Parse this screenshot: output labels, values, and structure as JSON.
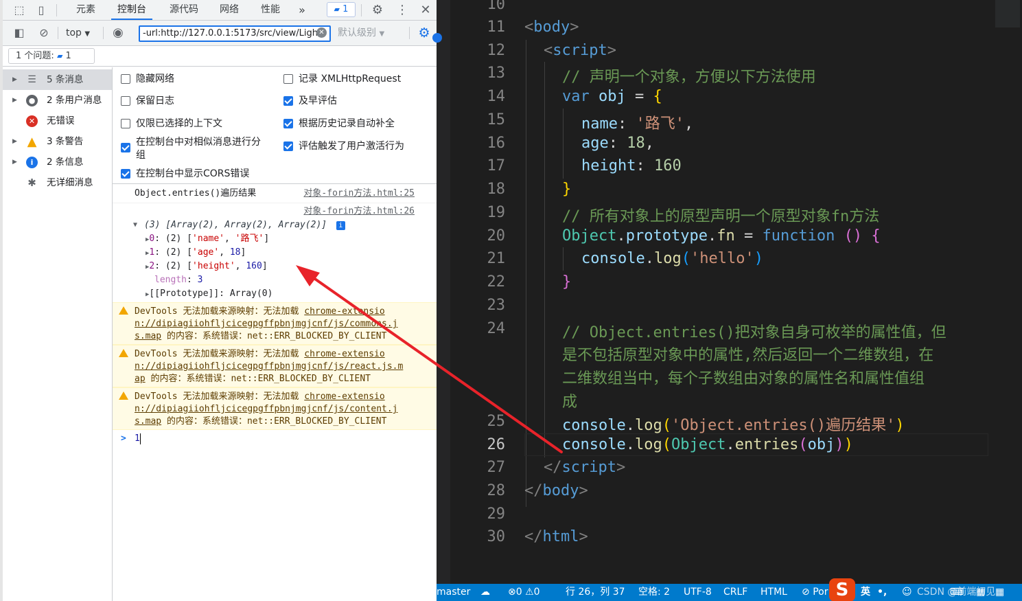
{
  "devtools": {
    "tabs": [
      {
        "label": "元素"
      },
      {
        "label": "控制台"
      },
      {
        "label": "源代码"
      },
      {
        "label": "网络"
      },
      {
        "label": "性能"
      }
    ],
    "more_tabs": "»",
    "message_badge": "1",
    "context_select": "top",
    "filter_value": "-url:http://127.0.0.1:5173/src/view/Ligh",
    "level_select": "默认级别",
    "issues_label": "1 个问题:",
    "issues_count": "1",
    "sidebar": [
      {
        "label": "5 条消息",
        "icon": "list-icon"
      },
      {
        "label": "2 条用户消息",
        "icon": "user-icon"
      },
      {
        "label": "无错误",
        "icon": "error-icon"
      },
      {
        "label": "3 条警告",
        "icon": "warning-icon"
      },
      {
        "label": "2 条信息",
        "icon": "info-icon"
      },
      {
        "label": "无详细消息",
        "icon": "bug-icon"
      }
    ],
    "settings": {
      "hide_network": "隐藏网络",
      "preserve_log": "保留日志",
      "selected_context": "仅限已选择的上下文",
      "group_similar_a": "在控制台中对相似消息进行分",
      "group_similar_b": "组",
      "show_cors": "在控制台中显示CORS错误",
      "log_xhr": "记录 XMLHttpRequest",
      "eager_eval": "及早评估",
      "autocomplete": "根据历史记录自动补全",
      "user_activation": "评估触发了用户激活行为"
    },
    "console": {
      "log1_text": "Object.entries()遍历结果",
      "log1_src": "对象-forin方法.html:25",
      "log2_src": "对象-forin方法.html:26",
      "array_summary": "(3) [Array(2), Array(2), Array(2)]",
      "row0_key": "0",
      "row0_len": "(2)",
      "row0_a": "'name'",
      "row0_b": "'路飞'",
      "row1_key": "1",
      "row1_len": "(2)",
      "row1_a": "'age'",
      "row1_b": "18",
      "row2_key": "2",
      "row2_len": "(2)",
      "row2_a": "'height'",
      "row2_b": "160",
      "length_key": "length",
      "length_val": "3",
      "proto": "[[Prototype]]: Array(0)",
      "warn_prefix": "DevTools 无法加载来源映射：无法加载",
      "warn1_link_a": "chrome-extensio",
      "warn1_link_b": "n://dipiagiiohfljcicegpgffpbnjmgjcnf/js/commons.j",
      "warn1_link_c": "s.map",
      "warn2_link_a": "chrome-extensio",
      "warn2_link_b": "n://dipiagiiohfljcicegpgffpbnjmgjcnf/js/react.js.m",
      "warn2_link_c": "ap",
      "warn3_link_a": "chrome-extensio",
      "warn3_link_b": "n://dipiagiiohfljcicegpgffpbnjmgjcnf/js/content.j",
      "warn3_link_c": "s.map",
      "warn_suffix": "的内容：系统错误：net::ERR_BLOCKED_BY_CLIENT",
      "prompt": ">",
      "input_value": "1"
    }
  },
  "editor": {
    "lines": [
      "10",
      "11",
      "12",
      "13",
      "14",
      "15",
      "16",
      "17",
      "18",
      "19",
      "20",
      "21",
      "22",
      "23",
      "24",
      "25",
      "26",
      "27",
      "28",
      "29",
      "30"
    ],
    "current_line": "26",
    "body_tag": "body",
    "script_tag": "script",
    "html_tag": "html",
    "comment1": "// 声明一个对象，方便以下方法使用",
    "kw_var": "var",
    "obj": "obj",
    "name_prop": "name",
    "name_val": "'路飞'",
    "age_prop": "age",
    "age_val": "18",
    "height_prop": "height",
    "height_val": "160",
    "comment2": "// 所有对象上的原型声明一个原型对象fn方法",
    "object_cls": "Object",
    "prototype": "prototype",
    "fn": "fn",
    "kw_function": "function",
    "console": "console",
    "log": "log",
    "hello": "'hello'",
    "comment3a": "// Object.entries()把对象自身可枚举的属性值，但",
    "comment3b": "是不包括原型对象中的属性,然后返回一个二维数组，在",
    "comment3c": "二维数组当中，每个子数组由对象的属性名和属性值组",
    "comment3d": "成",
    "log_str": "'Object.entries()遍历结果'",
    "entries": "entries"
  },
  "statusbar": {
    "branch": "master",
    "errors": "0",
    "warnings": "0",
    "position": "行 26，列 37",
    "spaces": "空格: 2",
    "encoding": "UTF-8",
    "eol": "CRLF",
    "language": "HTML",
    "port": "Por",
    "ime": "英",
    "watermark": "CSDN @前端初见"
  },
  "colors": {
    "accent": "#1a73e8",
    "annotation_arrow": "#e8232a",
    "status_bar": "#007acc",
    "editor_bg": "#1e1e1e"
  }
}
